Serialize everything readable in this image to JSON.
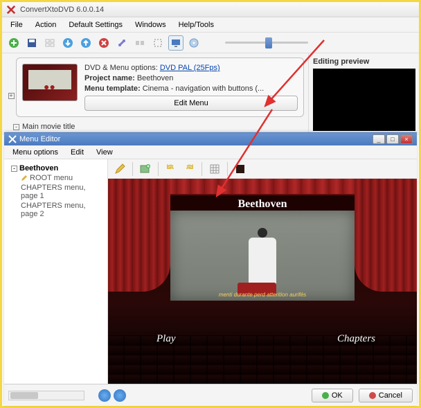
{
  "main": {
    "title": "ConvertXtoDVD 6.0.0.14",
    "menu": [
      "File",
      "Action",
      "Default Settings",
      "Windows",
      "Help/Tools"
    ],
    "toolbar_icons": [
      "add",
      "save",
      "layout",
      "down",
      "up",
      "delete",
      "settings",
      "merge",
      "crop",
      "monitor",
      "disc"
    ],
    "preview_heading": "Editing preview",
    "project": {
      "options_label": "DVD & Menu options:",
      "options_link": "DVD PAL (25Fps)",
      "name_label": "Project name:",
      "name_value": "Beethoven",
      "template_label": "Menu template:",
      "template_value": "Cinema - navigation with buttons (...",
      "edit_button": "Edit Menu"
    },
    "movie_title_label": "Main movie title"
  },
  "editor": {
    "title": "Menu Editor",
    "menu": [
      "Menu options",
      "Edit",
      "View"
    ],
    "tree": {
      "root": "Beethoven",
      "items": [
        "ROOT menu",
        "CHAPTERS menu, page 1",
        "CHAPTERS menu, page 2"
      ]
    },
    "toolbar_icons": [
      "pencil",
      "image-add",
      "undo",
      "redo",
      "grid",
      "color-swatch"
    ],
    "stage": {
      "title": "Beethoven",
      "subtitle": "menti durante perd atterition aurifés",
      "links": {
        "play": "Play",
        "chapters": "Chapters"
      }
    },
    "buttons": {
      "ok": "OK",
      "cancel": "Cancel"
    }
  },
  "colors": {
    "accent": "#4a7ac0",
    "curtain": "#a02020",
    "highlight": "#f5d742"
  }
}
